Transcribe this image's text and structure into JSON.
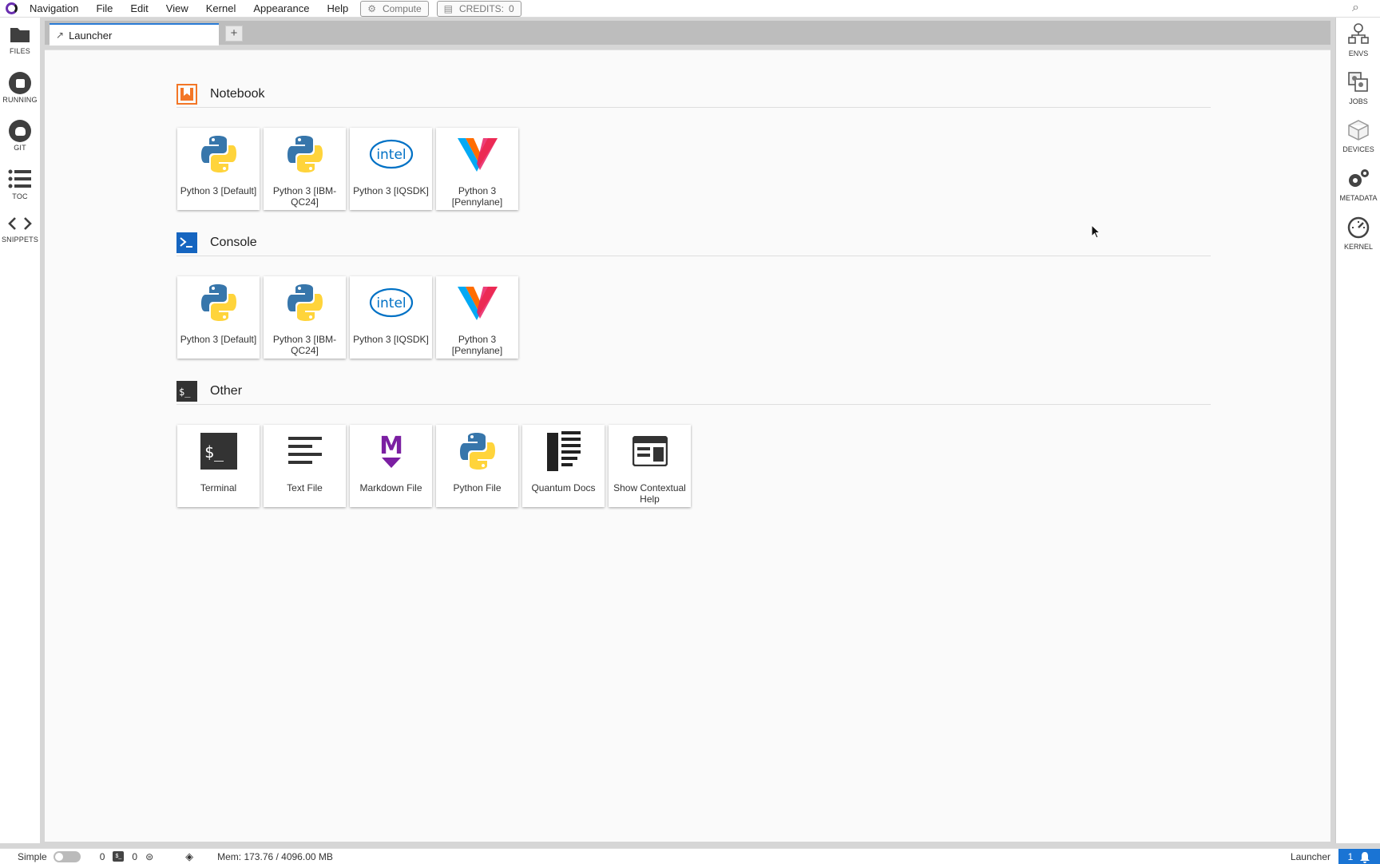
{
  "menubar": {
    "items": [
      "Navigation",
      "File",
      "Edit",
      "View",
      "Kernel",
      "Appearance",
      "Help"
    ],
    "compute_label": "Compute",
    "credits_label": "CREDITS:",
    "credits_value": "0"
  },
  "left_sidebar": [
    {
      "label": "FILES",
      "icon": "folder-icon"
    },
    {
      "label": "RUNNING",
      "icon": "stop-circle-icon"
    },
    {
      "label": "GIT",
      "icon": "git-icon"
    },
    {
      "label": "TOC",
      "icon": "list-icon"
    },
    {
      "label": "SNIPPETS",
      "icon": "code-icon"
    }
  ],
  "right_sidebar": [
    {
      "label": "ENVS",
      "icon": "envs-icon"
    },
    {
      "label": "JOBS",
      "icon": "jobs-icon"
    },
    {
      "label": "DEVICES",
      "icon": "cube-icon"
    },
    {
      "label": "METADATA",
      "icon": "gears-icon"
    },
    {
      "label": "KERNEL",
      "icon": "gauge-icon"
    }
  ],
  "tabs": {
    "active_label": "Launcher",
    "add_label": "+"
  },
  "launcher": {
    "sections": [
      {
        "title": "Notebook",
        "cards": [
          {
            "label": "Python 3 [Default]",
            "icon": "python-icon"
          },
          {
            "label": "Python 3 [IBM-QC24]",
            "icon": "python-icon"
          },
          {
            "label": "Python 3 [IQSDK]",
            "icon": "intel-icon"
          },
          {
            "label": "Python 3 [Pennylane]",
            "icon": "pennylane-icon"
          }
        ]
      },
      {
        "title": "Console",
        "cards": [
          {
            "label": "Python 3 [Default]",
            "icon": "python-icon"
          },
          {
            "label": "Python 3 [IBM-QC24]",
            "icon": "python-icon"
          },
          {
            "label": "Python 3 [IQSDK]",
            "icon": "intel-icon"
          },
          {
            "label": "Python 3 [Pennylane]",
            "icon": "pennylane-icon"
          }
        ]
      },
      {
        "title": "Other",
        "cards": [
          {
            "label": "Terminal",
            "icon": "terminal-icon"
          },
          {
            "label": "Text File",
            "icon": "text-file-icon"
          },
          {
            "label": "Markdown File",
            "icon": "markdown-icon"
          },
          {
            "label": "Python File",
            "icon": "python-icon"
          },
          {
            "label": "Quantum Docs",
            "icon": "docs-icon"
          },
          {
            "label": "Show Contextual Help",
            "icon": "help-panel-icon"
          }
        ]
      }
    ],
    "intel_text": "intel",
    "terminal_glyph": "$_",
    "markdown_glyph": "M"
  },
  "statusbar": {
    "mode_label": "Simple",
    "terminals_count": "0",
    "kernels_count": "0",
    "memory": "Mem: 173.76 / 4096.00 MB",
    "active_doc": "Launcher",
    "notifications": "1"
  },
  "colors": {
    "notebook_accent": "#f37626",
    "console_accent": "#1565c0",
    "other_accent": "#333333",
    "tab_accent": "#2a7bd5",
    "markdown_accent": "#7b1fa2"
  }
}
